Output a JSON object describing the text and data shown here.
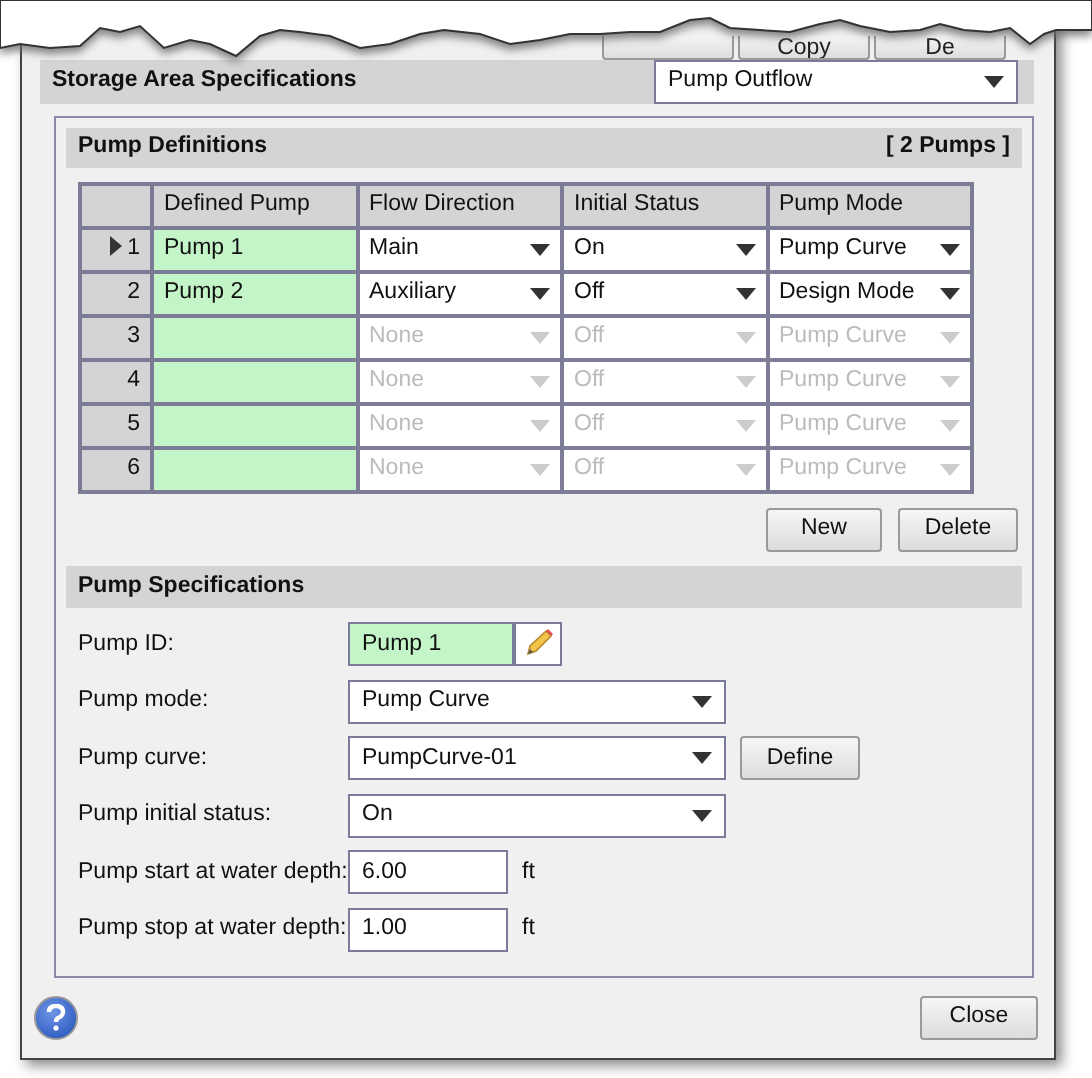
{
  "top_buttons": [
    {
      "kind": "blank"
    },
    {
      "kind": "text",
      "label": "Copy"
    },
    {
      "kind": "text",
      "label": "De"
    }
  ],
  "storage": {
    "title": "Storage Area Specifications",
    "type_value": "Pump Outflow"
  },
  "definitions": {
    "title": "Pump Definitions",
    "count": "[ 2 Pumps ]",
    "columns": [
      "Defined Pump",
      "Flow Direction",
      "Initial Status",
      "Pump Mode"
    ],
    "rows": [
      {
        "number": "1",
        "selected": true,
        "disabled": false,
        "pump": "Pump 1",
        "flow": "Main",
        "status": "On",
        "mode": "Pump Curve"
      },
      {
        "number": "2",
        "selected": false,
        "disabled": false,
        "pump": "Pump 2",
        "flow": "Auxiliary",
        "status": "Off",
        "mode": "Design Mode"
      },
      {
        "number": "3",
        "selected": false,
        "disabled": true,
        "flow": "None",
        "status": "Off",
        "mode": "Pump Curve"
      },
      {
        "number": "4",
        "selected": false,
        "disabled": true,
        "flow": "None",
        "status": "Off",
        "mode": "Pump Curve"
      },
      {
        "number": "5",
        "selected": false,
        "disabled": true,
        "flow": "None",
        "status": "Off",
        "mode": "Pump Curve"
      },
      {
        "number": "6",
        "selected": false,
        "disabled": true,
        "flow": "None",
        "status": "Off",
        "mode": "Pump Curve"
      }
    ],
    "buttons": [
      "New",
      "Delete"
    ]
  },
  "specifications": {
    "title": "Pump Specifications",
    "fields": [
      {
        "kind": "id",
        "label": "Pump ID:",
        "value": "Pump 1"
      },
      {
        "kind": "select",
        "label": "Pump mode:",
        "value": "Pump Curve"
      },
      {
        "kind": "select",
        "label": "Pump curve:",
        "value": "PumpCurve-01",
        "button": "Define"
      },
      {
        "kind": "select",
        "label": "Pump initial status:",
        "value": "On"
      },
      {
        "kind": "number",
        "label": "Pump start at water depth:",
        "value": "6.00",
        "unit": "ft"
      },
      {
        "kind": "number",
        "label": "Pump stop at water depth:",
        "value": "1.00",
        "unit": "ft"
      }
    ]
  },
  "footer": {
    "close": "Close"
  }
}
